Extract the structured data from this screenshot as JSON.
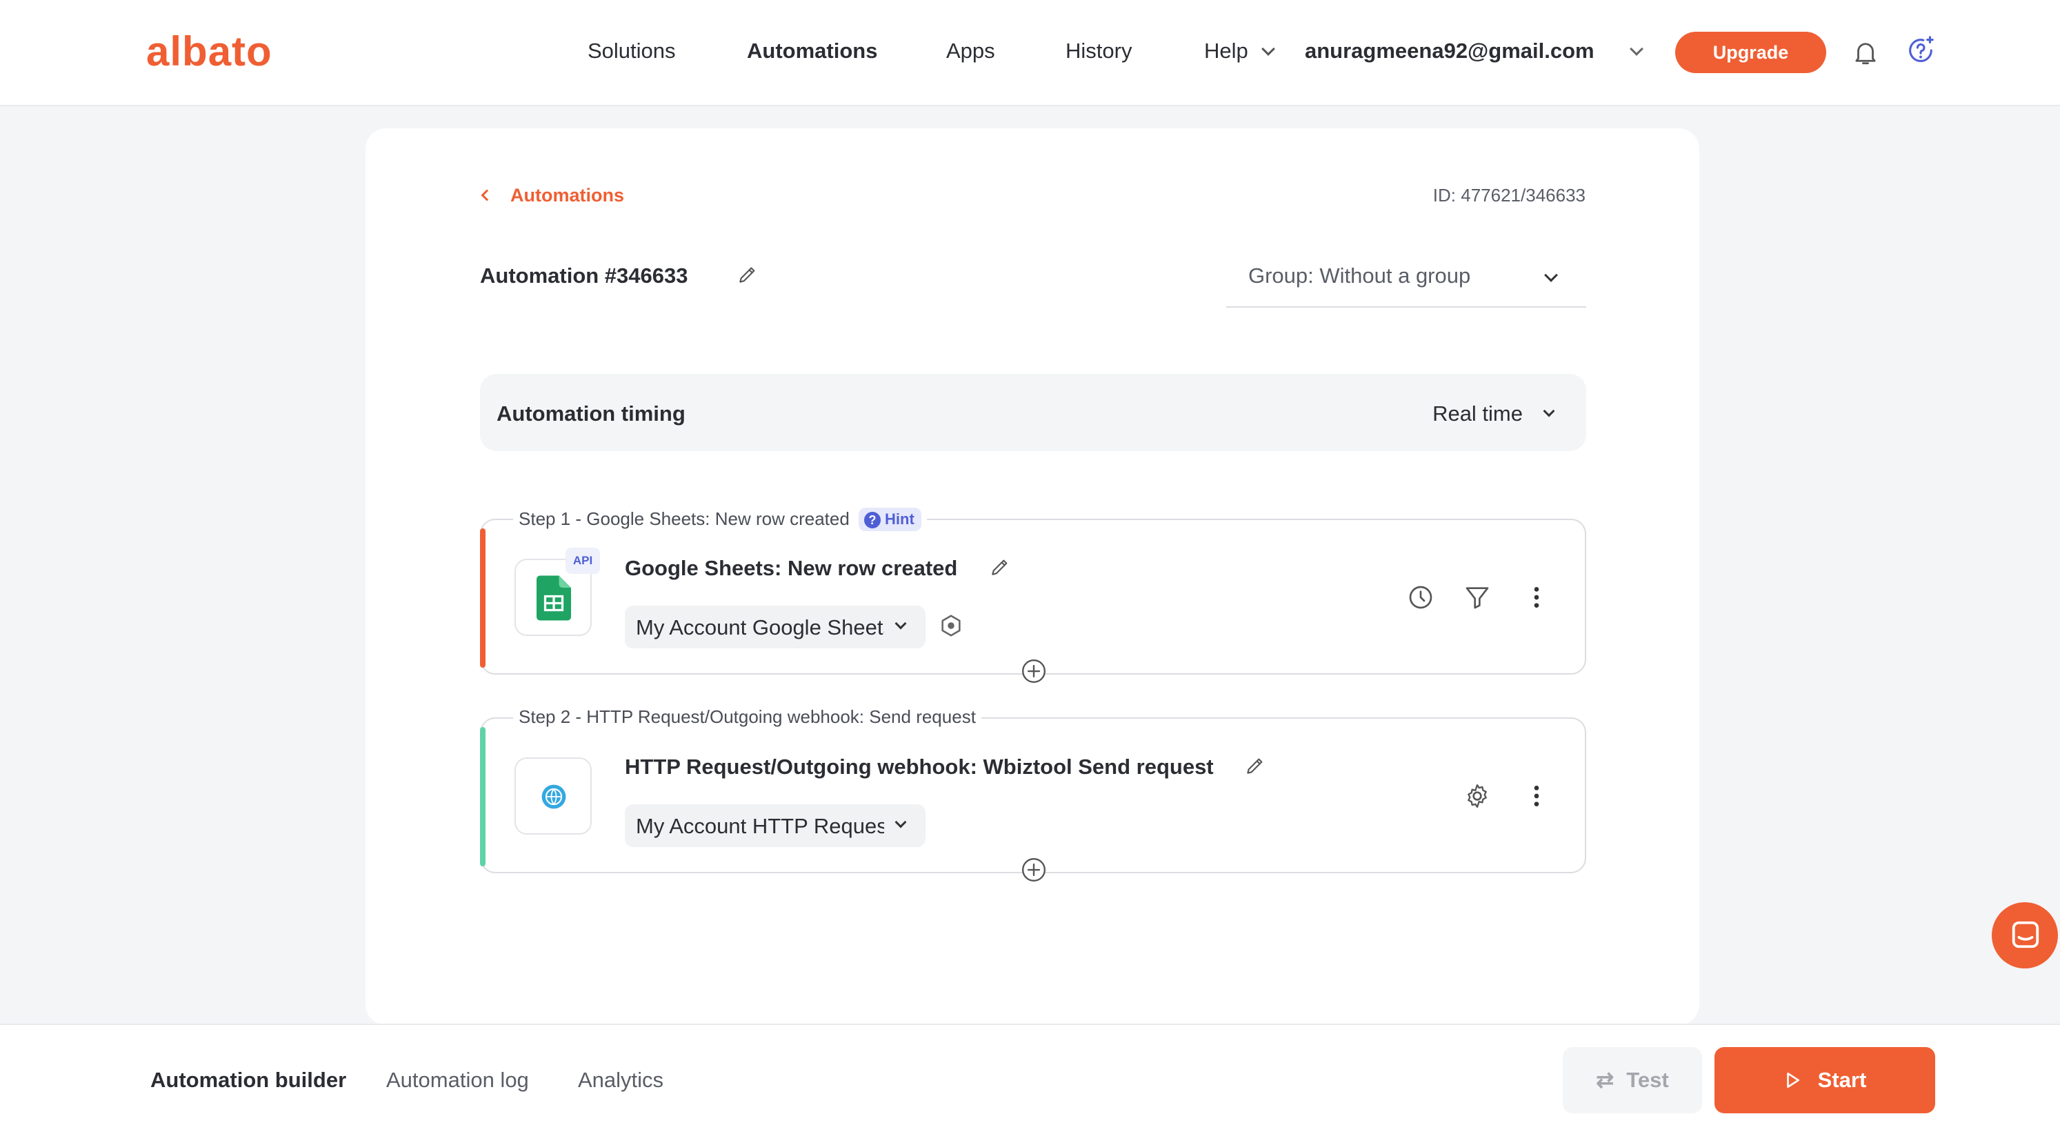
{
  "brand": {
    "logo": "albato",
    "accent": "#ef5f33"
  },
  "nav": {
    "items": [
      {
        "label": "Solutions"
      },
      {
        "label": "Automations",
        "active": true
      },
      {
        "label": "Apps"
      },
      {
        "label": "History"
      },
      {
        "label": "Help",
        "has_dropdown": true
      }
    ],
    "user_email": "anuragmeena92@gmail.com",
    "upgrade_label": "Upgrade"
  },
  "breadcrumb": {
    "back_label": "Automations"
  },
  "automation": {
    "id_text": "ID: 477621/346633",
    "title": "Automation #346633",
    "group": "Group: Without a group",
    "timing_label": "Automation timing",
    "timing_value": "Real time"
  },
  "steps": [
    {
      "caption": "Step 1 - Google Sheets: New row created",
      "hint_label": "Hint",
      "title": "Google Sheets: New row created",
      "badge": "API",
      "account": "My Account Google Sheets",
      "bar_color": "#ef5f33",
      "icons": [
        "clock-icon",
        "filter-icon",
        "more-vertical-icon"
      ]
    },
    {
      "caption": "Step 2 - HTTP Request/Outgoing webhook: Send request",
      "title": "HTTP Request/Outgoing webhook: Wbiztool Send request",
      "account": "My Account HTTP Request",
      "bar_color": "#5fd3a8",
      "icons": [
        "gear-icon",
        "more-vertical-icon"
      ]
    }
  ],
  "footer": {
    "tabs": [
      {
        "label": "Automation builder",
        "active": true
      },
      {
        "label": "Automation log"
      },
      {
        "label": "Analytics"
      }
    ],
    "test_label": "Test",
    "start_label": "Start"
  }
}
